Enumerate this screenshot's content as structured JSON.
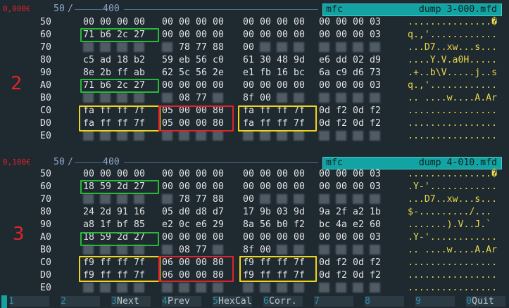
{
  "pane1": {
    "price": "0,000€",
    "left_num": "50",
    "sep": "/",
    "right_num": "400",
    "title_prefix": "mfc",
    "title_name": "dump 3-000.mfd",
    "label": "2",
    "rows": [
      {
        "off": "50",
        "hex": [
          "00",
          "00",
          "00",
          "00",
          "00",
          "00",
          "00",
          "00",
          "00",
          "00",
          "00",
          "00",
          "00",
          "00",
          "00",
          "03"
        ],
        "ascii": "...............�"
      },
      {
        "off": "60",
        "hex": [
          "71",
          "b6",
          "2c",
          "27",
          "00",
          "00",
          "00",
          "00",
          "00",
          "00",
          "00",
          "00",
          "00",
          "00",
          "00",
          "03"
        ],
        "ascii": "q.,'............"
      },
      {
        "off": "70",
        "hex": [
          "",
          "",
          "",
          "",
          "",
          "78",
          "77",
          "88",
          "00",
          "",
          "",
          "",
          "",
          "",
          "",
          ""
        ],
        "ascii": "...D7..xw...s..."
      },
      {
        "off": "80",
        "hex": [
          "c5",
          "ad",
          "18",
          "b2",
          "59",
          "eb",
          "56",
          "c0",
          "61",
          "30",
          "48",
          "9d",
          "e6",
          "dd",
          "02",
          "d9"
        ],
        "ascii": "....Y.V.a0H....."
      },
      {
        "off": "90",
        "hex": [
          "8e",
          "2b",
          "ff",
          "ab",
          "62",
          "5c",
          "56",
          "2e",
          "e1",
          "fb",
          "16",
          "bc",
          "6a",
          "c9",
          "d6",
          "73"
        ],
        "ascii": ".+..b\\V.....j..s"
      },
      {
        "off": "A0",
        "hex": [
          "71",
          "b6",
          "2c",
          "27",
          "00",
          "00",
          "00",
          "00",
          "00",
          "00",
          "00",
          "00",
          "00",
          "00",
          "00",
          "03"
        ],
        "ascii": "q.,'............"
      },
      {
        "off": "B0",
        "hex": [
          "",
          "",
          "",
          "",
          "",
          "08",
          "77",
          "",
          "8f",
          "00",
          "",
          "",
          "",
          "",
          "",
          ""
        ],
        "ascii": ".. ....w....A.Ar"
      },
      {
        "off": "C0",
        "hex": [
          "fa",
          "ff",
          "ff",
          "7f",
          "05",
          "00",
          "00",
          "80",
          "fa",
          "ff",
          "ff",
          "7f",
          "0d",
          "f2",
          "0d",
          "f2"
        ],
        "ascii": "................"
      },
      {
        "off": "D0",
        "hex": [
          "fa",
          "ff",
          "ff",
          "7f",
          "05",
          "00",
          "00",
          "80",
          "fa",
          "ff",
          "ff",
          "7f",
          "0d",
          "f2",
          "0d",
          "f2"
        ],
        "ascii": "................"
      },
      {
        "off": "E0",
        "hex": [
          "",
          "",
          "",
          "",
          "",
          "",
          "",
          "",
          "",
          "",
          "",
          "",
          "",
          "",
          "",
          ""
        ],
        "ascii": "................"
      }
    ]
  },
  "pane2": {
    "price": "0,100€",
    "left_num": "50",
    "sep": "/",
    "right_num": "400",
    "title_prefix": "mfc",
    "title_name": "dump 4-010.mfd",
    "label": "3",
    "rows": [
      {
        "off": "50",
        "hex": [
          "00",
          "00",
          "00",
          "00",
          "00",
          "00",
          "00",
          "00",
          "00",
          "00",
          "00",
          "00",
          "00",
          "00",
          "00",
          "03"
        ],
        "ascii": "...............�"
      },
      {
        "off": "60",
        "hex": [
          "18",
          "59",
          "2d",
          "27",
          "00",
          "00",
          "00",
          "00",
          "00",
          "00",
          "00",
          "00",
          "00",
          "00",
          "00",
          "03"
        ],
        "ascii": ".Y-'............"
      },
      {
        "off": "70",
        "hex": [
          "",
          "",
          "",
          "",
          "",
          "78",
          "77",
          "88",
          "00",
          "",
          "",
          "",
          "",
          "",
          "",
          ""
        ],
        "ascii": "...D7..xw...s..."
      },
      {
        "off": "80",
        "hex": [
          "24",
          "2d",
          "91",
          "16",
          "05",
          "d0",
          "d8",
          "d7",
          "17",
          "9b",
          "03",
          "9d",
          "9a",
          "2f",
          "a2",
          "1b"
        ],
        "ascii": "$-........./..."
      },
      {
        "off": "90",
        "hex": [
          "a8",
          "1f",
          "bf",
          "85",
          "e2",
          "0c",
          "e6",
          "29",
          "8a",
          "56",
          "b0",
          "f2",
          "bc",
          "4a",
          "e2",
          "60"
        ],
        "ascii": ".......).V..J.`"
      },
      {
        "off": "A0",
        "hex": [
          "18",
          "59",
          "2d",
          "27",
          "00",
          "00",
          "00",
          "00",
          "00",
          "00",
          "00",
          "00",
          "00",
          "00",
          "00",
          "03"
        ],
        "ascii": ".Y-'............"
      },
      {
        "off": "B0",
        "hex": [
          "",
          "",
          "",
          "",
          "",
          "08",
          "77",
          "",
          "8f",
          "00",
          "",
          "",
          "",
          "",
          "",
          ""
        ],
        "ascii": ".. ....w....A.Ar"
      },
      {
        "off": "C0",
        "hex": [
          "f9",
          "ff",
          "ff",
          "7f",
          "06",
          "00",
          "00",
          "80",
          "f9",
          "ff",
          "ff",
          "7f",
          "0d",
          "f2",
          "0d",
          "f2"
        ],
        "ascii": "................"
      },
      {
        "off": "D0",
        "hex": [
          "f9",
          "ff",
          "ff",
          "7f",
          "06",
          "00",
          "00",
          "80",
          "f9",
          "ff",
          "ff",
          "7f",
          "0d",
          "f2",
          "0d",
          "f2"
        ],
        "ascii": "................"
      },
      {
        "off": "E0",
        "hex": [
          "",
          "",
          "",
          "",
          "",
          "",
          "",
          "",
          "",
          "",
          "",
          "",
          "",
          "",
          "",
          ""
        ],
        "ascii": "................"
      }
    ]
  },
  "statusbar": {
    "keys": [
      {
        "num": "1",
        "label": ""
      },
      {
        "num": "2",
        "label": ""
      },
      {
        "num": "3",
        "label": "Next"
      },
      {
        "num": "4",
        "label": "Prev"
      },
      {
        "num": "5",
        "label": "HexCal"
      },
      {
        "num": "6",
        "label": "Corr."
      },
      {
        "num": "7",
        "label": ""
      },
      {
        "num": "8",
        "label": ""
      },
      {
        "num": "9",
        "label": ""
      },
      {
        "num": "0",
        "label": "Quit"
      }
    ]
  },
  "colors": {
    "background": "#1e2930",
    "title_bg": "#14a3a3",
    "green_box": "#28b83a",
    "yellow_box": "#f2d41a",
    "red_box": "#e0242a",
    "ascii": "#e8d84a"
  }
}
